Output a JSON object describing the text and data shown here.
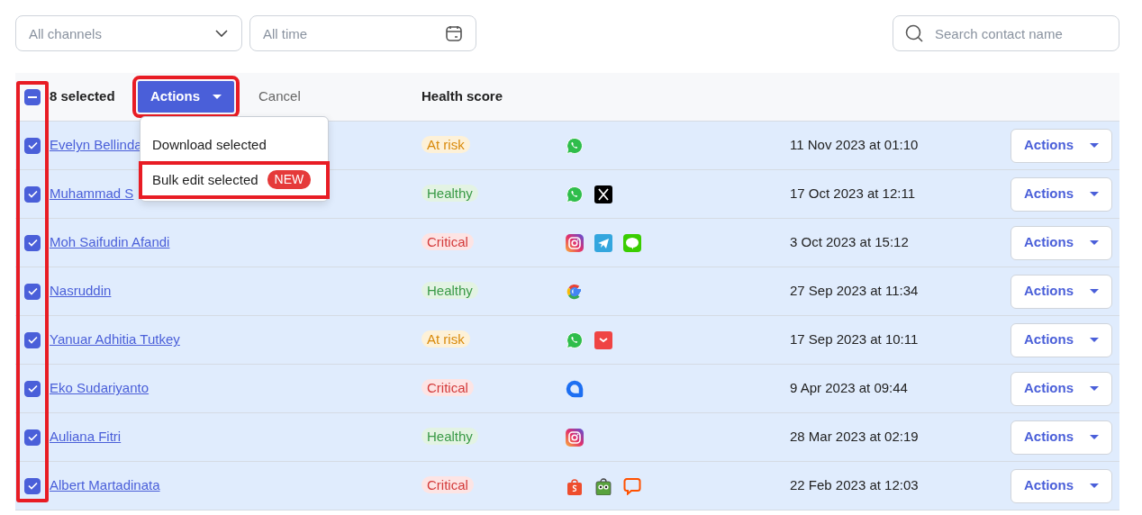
{
  "filters": {
    "channel": {
      "placeholder": "All channels"
    },
    "time": {
      "placeholder": "All time"
    },
    "search": {
      "placeholder": "Search contact name"
    }
  },
  "table_header": {
    "select_all": {
      "indeterminate": true
    },
    "selected_count": "8 selected",
    "actions_button": "Actions",
    "cancel_button": "Cancel",
    "health_column": "Health score"
  },
  "actions_menu": {
    "open": true,
    "items": [
      {
        "label": "Download selected"
      },
      {
        "label": "Bulk edit selected",
        "badge": "NEW"
      }
    ]
  },
  "rows": [
    {
      "name": "Evelyn Bellinda",
      "selected": true,
      "health": {
        "text": "At risk",
        "kind": "at_risk"
      },
      "channels": [
        {
          "kind": "whatsapp"
        }
      ],
      "date": "11 Nov 2023 at 01:10",
      "action": "Actions"
    },
    {
      "name": "Muhammad S",
      "selected": true,
      "health": {
        "text": "Healthy",
        "kind": "healthy"
      },
      "channels": [
        {
          "kind": "whatsapp"
        },
        {
          "kind": "x"
        }
      ],
      "date": "17 Oct 2023 at 12:11",
      "action": "Actions"
    },
    {
      "name": "Moh Saifudin Afandi",
      "selected": true,
      "health": {
        "text": "Critical",
        "kind": "critical"
      },
      "channels": [
        {
          "kind": "instagram"
        },
        {
          "kind": "telegram"
        },
        {
          "kind": "line"
        }
      ],
      "date": "3 Oct 2023 at 15:12",
      "action": "Actions"
    },
    {
      "name": "Nasruddin",
      "selected": true,
      "health": {
        "text": "Healthy",
        "kind": "healthy"
      },
      "channels": [
        {
          "kind": "google"
        }
      ],
      "date": "27 Sep 2023 at 11:34",
      "action": "Actions"
    },
    {
      "name": "Yanuar Adhitia Tutkey",
      "selected": true,
      "health": {
        "text": "At risk",
        "kind": "at_risk"
      },
      "channels": [
        {
          "kind": "whatsapp"
        },
        {
          "kind": "email"
        }
      ],
      "date": "17 Sep 2023 at 10:11",
      "action": "Actions"
    },
    {
      "name": "Eko Sudariyanto",
      "selected": true,
      "health": {
        "text": "Critical",
        "kind": "critical"
      },
      "channels": [
        {
          "kind": "webchat"
        }
      ],
      "date": "9 Apr 2023 at 09:44",
      "action": "Actions"
    },
    {
      "name": "Auliana Fitri",
      "selected": true,
      "health": {
        "text": "Healthy",
        "kind": "healthy"
      },
      "channels": [
        {
          "kind": "instagram"
        }
      ],
      "date": "28 Mar 2023 at 02:19",
      "action": "Actions"
    },
    {
      "name": "Albert Martadinata",
      "selected": true,
      "health": {
        "text": "Critical",
        "kind": "critical"
      },
      "channels": [
        {
          "kind": "shopee"
        },
        {
          "kind": "tokopedia"
        },
        {
          "kind": "livechat"
        }
      ],
      "date": "22 Feb 2023 at 12:03",
      "action": "Actions"
    }
  ],
  "highlights": [
    {
      "kind": "checkbox_column"
    },
    {
      "kind": "actions_button"
    },
    {
      "kind": "bulk_edit_item"
    }
  ]
}
